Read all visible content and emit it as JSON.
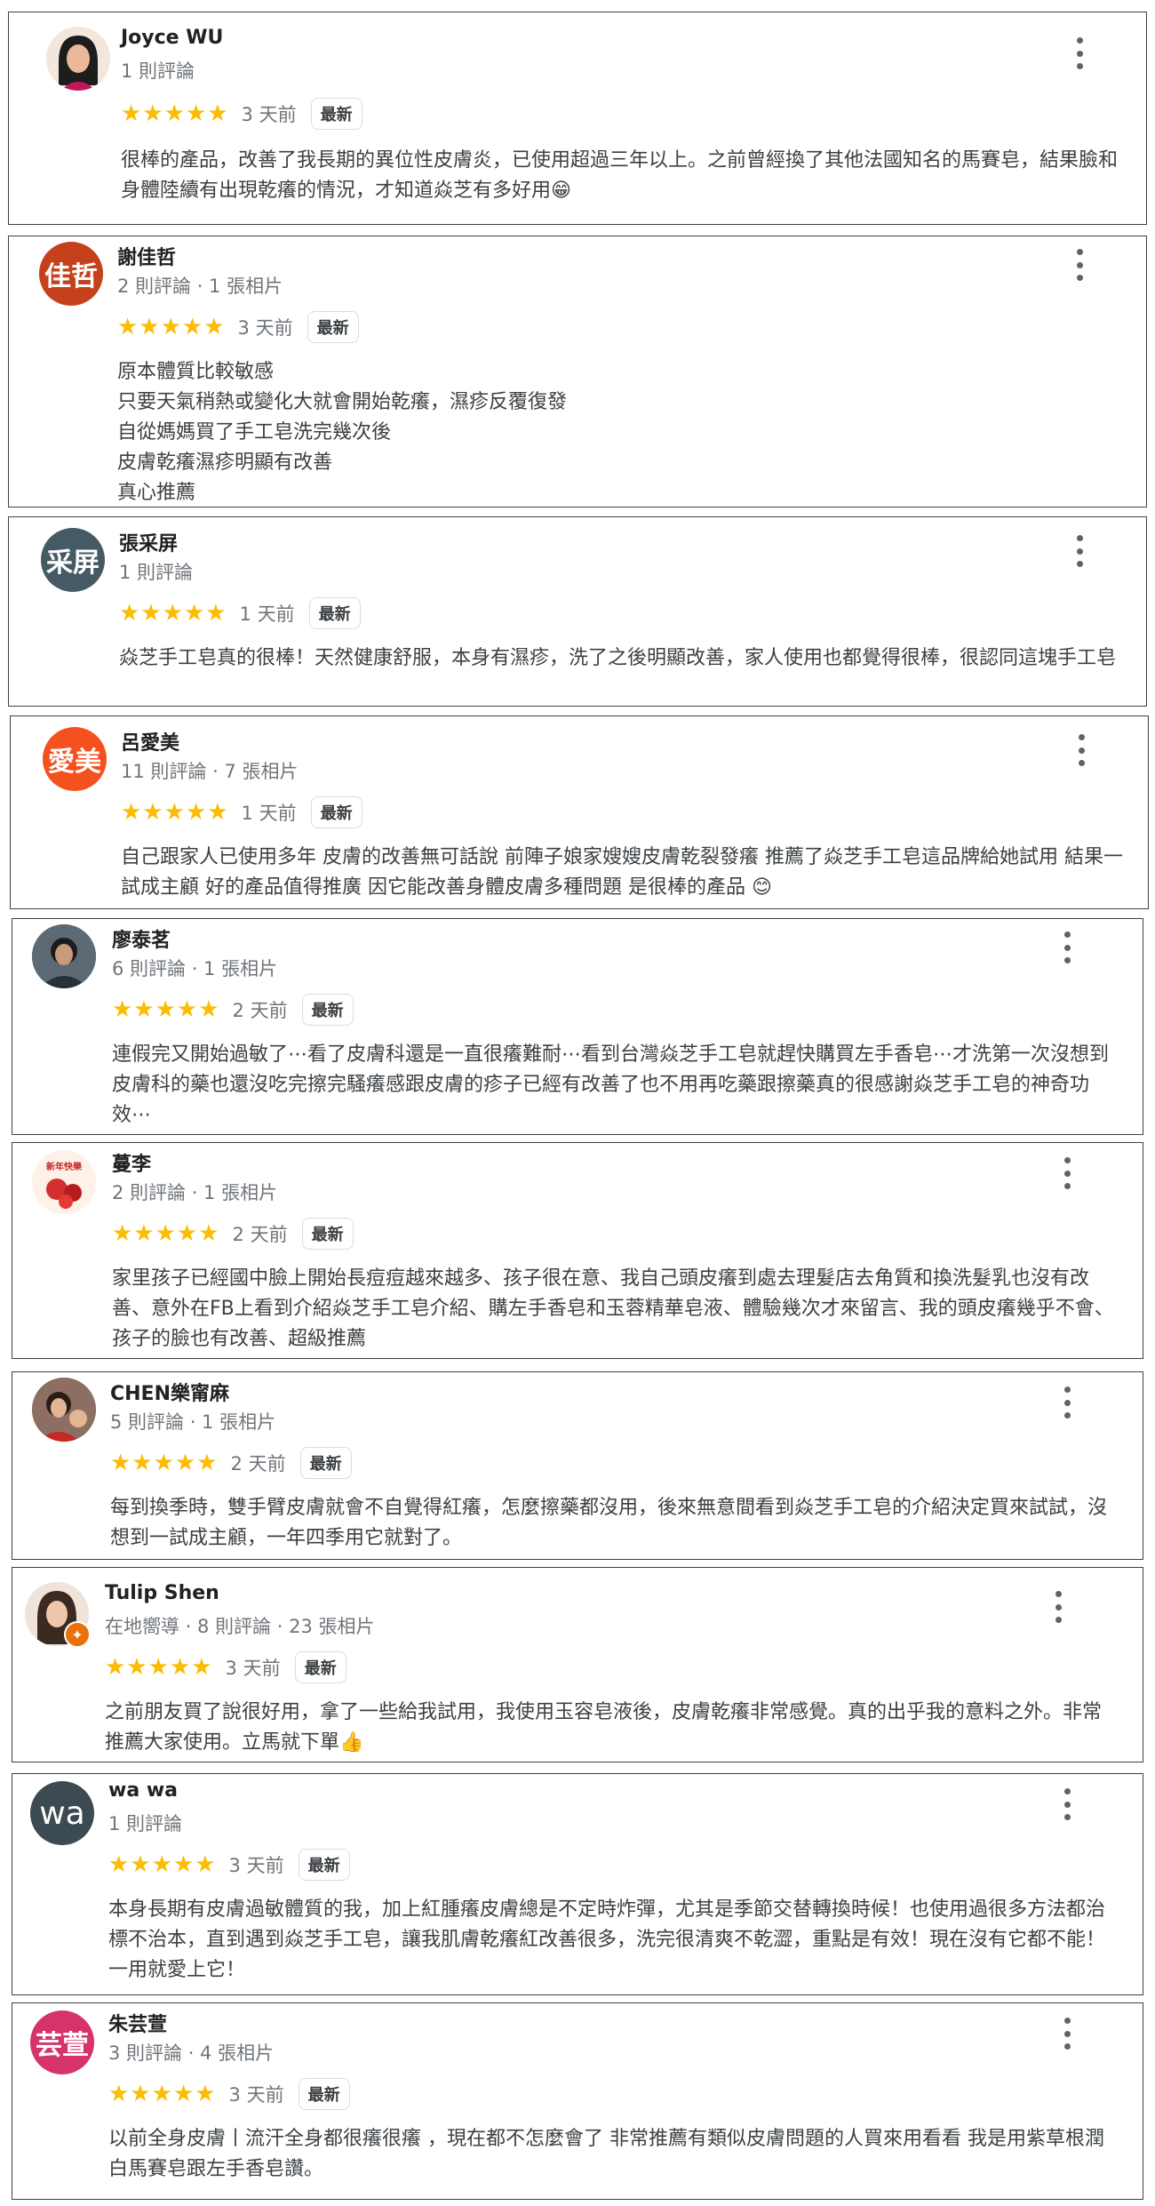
{
  "ui": {
    "star_glyphs": "★★★★★",
    "latest_badge": "最新"
  },
  "reviews": [
    {
      "name": "Joyce WU",
      "meta": "1 則評論",
      "time": "3 天前",
      "avatar_text": "",
      "text": "很棒的產品，改善了我長期的異位性皮膚炎，已使用超過三年以上。之前曾經換了其他法國知名的馬賽皂，結果臉和身體陸續有出現乾癢的情況，才知道焱芝有多好用😁"
    },
    {
      "name": "謝佳哲",
      "meta": "2 則評論 · 1 張相片",
      "time": "3 天前",
      "avatar_text": "佳哲",
      "avatar_color": "#c5411c",
      "text": "原本體質比較敏感\n只要天氣稍熱或變化大就會開始乾癢，濕疹反覆復發\n自從媽媽買了手工皂洗完幾次後\n皮膚乾癢濕疹明顯有改善\n真心推薦"
    },
    {
      "name": "張采屏",
      "meta": "1 則評論",
      "time": "1 天前",
      "avatar_text": "采屏",
      "avatar_color": "#455a64",
      "text": "焱芝手工皂真的很棒！天然健康舒服，本身有濕疹，洗了之後明顯改善，家人使用也都覺得很棒，很認同這塊手工皂"
    },
    {
      "name": "呂愛美",
      "meta": "11 則評論 · 7 張相片",
      "time": "1 天前",
      "avatar_text": "愛美",
      "avatar_color": "#f4511e",
      "text": "自己跟家人已使用多年  皮膚的改善無可話說  前陣子娘家嫂嫂皮膚乾裂發癢  推薦了焱芝手工皂這品牌給她試用  結果一試成主顧    好的產品值得推廣  因它能改善身體皮膚多種問題    是很棒的產品 😊"
    },
    {
      "name": "廖泰茗",
      "meta": "6 則評論 · 1 張相片",
      "time": "2 天前",
      "avatar_text": "",
      "text": "連假完又開始過敏了⋯看了皮膚科還是一直很癢難耐⋯看到台灣焱芝手工皂就趕快購買左手香皂⋯才洗第一次沒想到皮膚科的藥也還沒吃完擦完騷癢感跟皮膚的疹子已經有改善了也不用再吃藥跟擦藥真的很感謝焱芝手工皂的神奇功效⋯"
    },
    {
      "name": "蔓李",
      "meta": "2 則評論 · 1 張相片",
      "time": "2 天前",
      "avatar_text": "",
      "text": "家里孩子已經國中臉上開始長痘痘越來越多、孩子很在意、我自己頭皮癢到處去理髮店去角質和換洗髮乳也沒有改善、意外在FB上看到介紹焱芝手工皂介紹、購左手香皂和玉蓉精華皂液、體驗幾次才來留言、我的頭皮癢幾乎不會、孩子的臉也有改善、超級推薦"
    },
    {
      "name": "CHEN樂甯麻",
      "meta": "5 則評論 · 1 張相片",
      "time": "2 天前",
      "avatar_text": "",
      "text": "每到換季時，雙手臂皮膚就會不自覺得紅癢，怎麼擦藥都沒用，後來無意間看到焱芝手工皂的介紹決定買來試試，沒想到一試成主顧，一年四季用它就對了。"
    },
    {
      "name": "Tulip Shen",
      "meta": "在地嚮導 · 8 則評論 · 23 張相片",
      "time": "3 天前",
      "avatar_text": "",
      "text": "之前朋友買了說很好用，拿了一些給我試用，我使用玉容皂液後，皮膚乾癢非常感覺。真的出乎我的意料之外。非常推薦大家使用。立馬就下單👍"
    },
    {
      "name": "wa wa",
      "meta": "1 則評論",
      "time": "3 天前",
      "avatar_text": "wa",
      "avatar_color": "#3c4a52",
      "text": "本身長期有皮膚過敏體質的我，加上紅腫癢皮膚總是不定時炸彈，尤其是季節交替轉換時候！也使用過很多方法都治標不治本，直到遇到焱芝手工皂，讓我肌膚乾癢紅改善很多，洗完很清爽不乾澀，重點是有效！現在沒有它都不能！一用就愛上它！"
    },
    {
      "name": "朱芸萱",
      "meta": "3 則評論 · 4 張相片",
      "time": "3 天前",
      "avatar_text": "芸萱",
      "avatar_color": "#d6336c",
      "text": "以前全身皮膚丨流汗全身都很癢很癢 ，現在都不怎麼會了 非常推薦有類似皮膚問題的人買來用看看 我是用紫草根潤白馬賽皂跟左手香皂讚。"
    }
  ]
}
